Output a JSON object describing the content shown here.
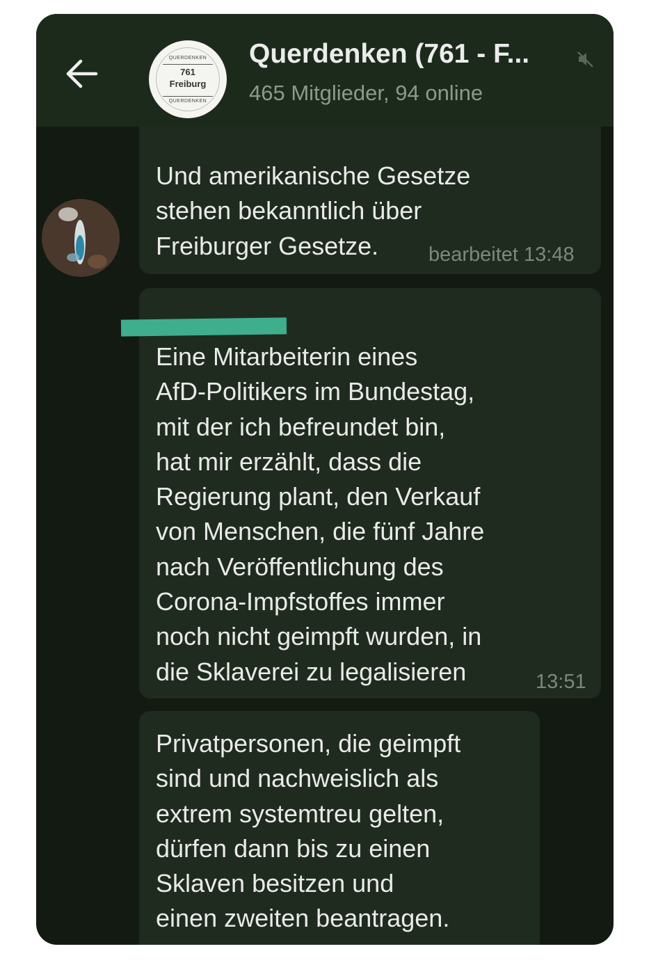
{
  "header": {
    "title": "Querdenken (761 - F...",
    "subtitle": "465 Mitglieder, 94 online",
    "back_icon": "arrow-left-icon",
    "mute_icon": "mute-icon",
    "group_avatar": {
      "brand": "QUERDENKEN",
      "number": "761",
      "city": "Freiburg"
    }
  },
  "messages": [
    {
      "text": "Und amerikanische Gesetze\nstehen bekanntlich über\nFreiburger Gesetze.",
      "timestamp": "bearbeitet 13:48"
    },
    {
      "sender": "",
      "text": "Eine Mitarbeiterin eines\nAfD-Politikers im Bundestag,\nmit der ich befreundet bin,\nhat mir erzählt, dass die\nRegierung plant, den Verkauf\nvon Menschen, die fünf Jahre\nnach Veröffentlichung des\nCorona-Impfstoffes immer\nnoch nicht geimpft wurden, in\ndie Sklaverei zu legalisieren",
      "timestamp": "13:51"
    },
    {
      "text": "Privatpersonen, die geimpft\nsind und nachweislich als\nextrem systemtreu gelten,\ndürfen dann bis zu einen\nSklaven besitzen und\neinen zweiten beantragen.",
      "timestamp": ""
    }
  ],
  "colors": {
    "background": "#121a12",
    "header": "#1c2a1c",
    "bubble": "#1f2b1f",
    "text": "#eaeaea",
    "timestamp": "#7d887d",
    "redaction": "#3fae8d"
  }
}
